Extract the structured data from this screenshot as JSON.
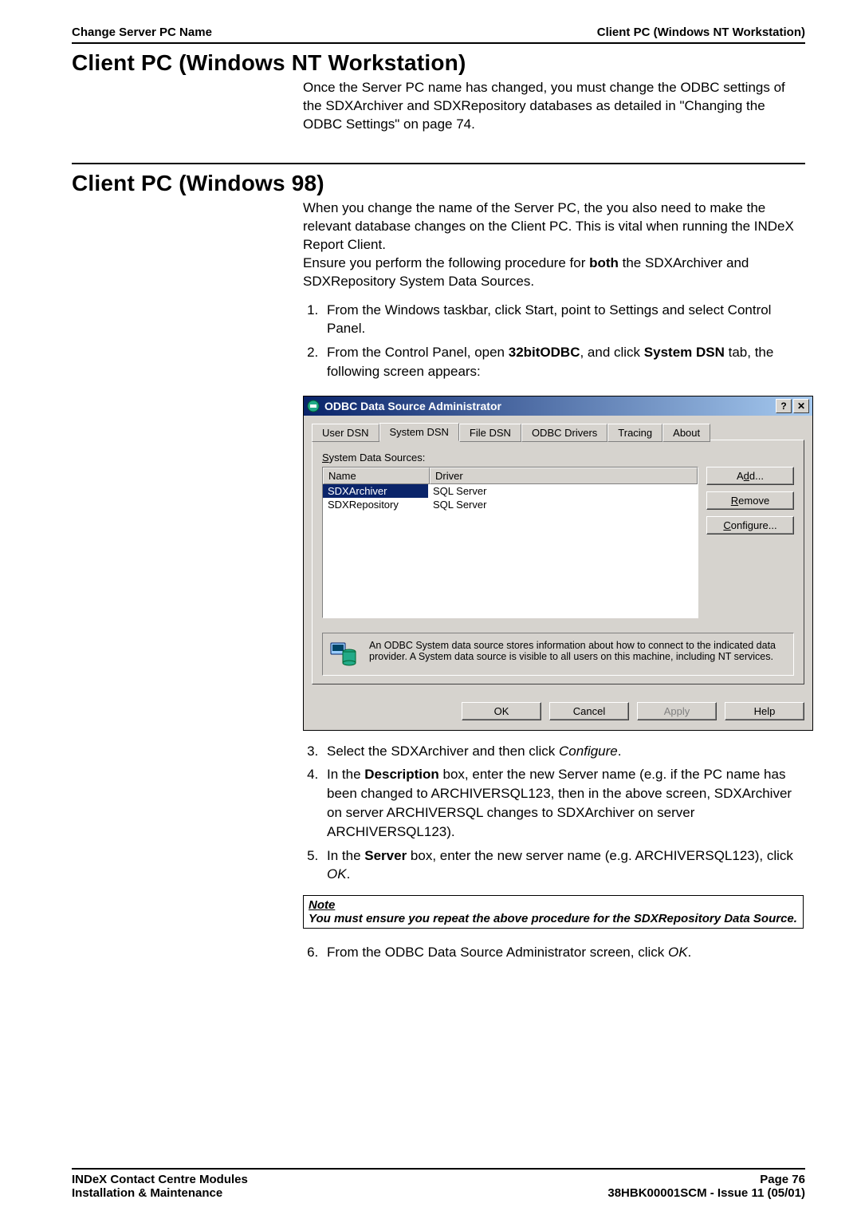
{
  "header": {
    "left": "Change Server PC Name",
    "right": "Client PC (Windows NT Workstation)"
  },
  "section1": {
    "title": "Client PC (Windows NT Workstation)",
    "para": "Once the Server PC name has changed, you must change the ODBC settings of the SDXArchiver and SDXRepository databases as detailed in \"Changing the ODBC Settings\" on page 74."
  },
  "section2": {
    "title": "Client PC (Windows 98)",
    "para1": "When you change the name of the Server PC, the you also need to make the relevant database changes on the Client PC.  This is vital when running the INDeX Report Client.",
    "para2a": "Ensure you perform the following procedure for ",
    "para2b": "both",
    "para2c": " the SDXArchiver and SDXRepository System Data Sources."
  },
  "steps": {
    "s1": "From the Windows taskbar, click Start, point to Settings and select Control Panel.",
    "s2a": "From the Control Panel, open ",
    "s2b": "32bitODBC",
    "s2c": ", and click ",
    "s2d": "System DSN",
    "s2e": " tab, the following screen appears:",
    "s3a": "Select the SDXArchiver and then click ",
    "s3b": "Configure",
    "s3c": ".",
    "s4a": "In the ",
    "s4b": "Description",
    "s4c": " box, enter the new Server name (e.g. if the PC name has been changed to ARCHIVERSQL123, then in the above screen, SDXArchiver on server ARCHIVERSQL changes to SDXArchiver on server ARCHIVERSQL123).",
    "s5a": "In the ",
    "s5b": "Server",
    "s5c": " box, enter the new server name (e.g. ARCHIVERSQL123), click ",
    "s5d": "OK",
    "s5e": ".",
    "s6a": "From the ODBC Data Source Administrator screen, click ",
    "s6b": "OK",
    "s6c": "."
  },
  "dialog": {
    "title": "ODBC Data Source Administrator",
    "help": "?",
    "close": "✕",
    "tabs": {
      "user": "User DSN",
      "system": "System DSN",
      "file": "File DSN",
      "drivers": "ODBC Drivers",
      "tracing": "Tracing",
      "about": "About"
    },
    "listlabel_pre": "S",
    "listlabel_post": "ystem Data Sources:",
    "columns": {
      "name": "Name",
      "driver": "Driver"
    },
    "rows": [
      {
        "name": "SDXArchiver",
        "driver": "SQL Server",
        "selected": true
      },
      {
        "name": "SDXRepository",
        "driver": "SQL Server",
        "selected": false
      }
    ],
    "buttons": {
      "add_pre": "A",
      "add_u": "d",
      "add_post": "d...",
      "remove_u": "R",
      "remove_post": "emove",
      "configure_u": "C",
      "configure_post": "onfigure..."
    },
    "info": "An ODBC System data source stores information about how to connect to the indicated data provider.   A System data source is visible to all users on this machine, including NT services.",
    "footer": {
      "ok": "OK",
      "cancel": "Cancel",
      "apply": "Apply",
      "help": "Help"
    }
  },
  "note": {
    "heading": "Note",
    "body": "You must ensure you repeat the above procedure for the SDXRepository Data Source."
  },
  "footer": {
    "left1": "INDeX Contact Centre Modules",
    "left2": "Installation & Maintenance",
    "right1": "Page 76",
    "right2": "38HBK00001SCM - Issue 11 (05/01)"
  }
}
